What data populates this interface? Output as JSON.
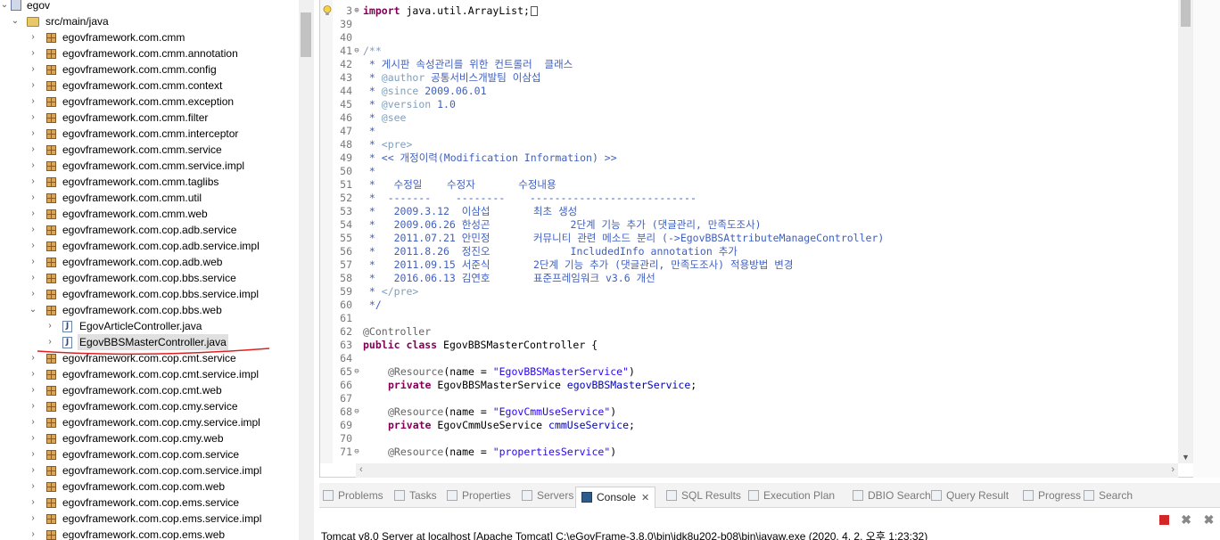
{
  "explorer": {
    "project": "egov",
    "source_folder": "src/main/java",
    "packages_before": [
      "egovframework.com.cmm",
      "egovframework.com.cmm.annotation",
      "egovframework.com.cmm.config",
      "egovframework.com.cmm.context",
      "egovframework.com.cmm.exception",
      "egovframework.com.cmm.filter",
      "egovframework.com.cmm.interceptor",
      "egovframework.com.cmm.service",
      "egovframework.com.cmm.service.impl",
      "egovframework.com.cmm.taglibs",
      "egovframework.com.cmm.util",
      "egovframework.com.cmm.web",
      "egovframework.com.cop.adb.service",
      "egovframework.com.cop.adb.service.impl",
      "egovframework.com.cop.adb.web",
      "egovframework.com.cop.bbs.service",
      "egovframework.com.cop.bbs.service.impl"
    ],
    "expanded_package": "egovframework.com.cop.bbs.web",
    "files": [
      "EgovArticleController.java",
      "EgovBBSMasterController.java"
    ],
    "selected_file": "EgovBBSMasterController.java",
    "packages_after": [
      "egovframework.com.cop.cmt.service",
      "egovframework.com.cop.cmt.service.impl",
      "egovframework.com.cop.cmt.web",
      "egovframework.com.cop.cmy.service",
      "egovframework.com.cop.cmy.service.impl",
      "egovframework.com.cop.cmy.web",
      "egovframework.com.cop.com.service",
      "egovframework.com.cop.com.service.impl",
      "egovframework.com.cop.com.web",
      "egovframework.com.cop.ems.service",
      "egovframework.com.cop.ems.service.impl",
      "egovframework.com.cop.ems.web"
    ]
  },
  "editor": {
    "lines": [
      {
        "n": "3",
        "fold": "⊕",
        "segs": [
          {
            "t": "import ",
            "c": "kw"
          },
          {
            "t": "java.util.ArrayList;"
          }
        ],
        "cursor": true
      },
      {
        "n": "39",
        "segs": []
      },
      {
        "n": "40",
        "segs": []
      },
      {
        "n": "41",
        "fold": "⊖",
        "segs": [
          {
            "t": "/**",
            "c": "jd"
          }
        ]
      },
      {
        "n": "42",
        "segs": [
          {
            "t": " * 게시판 속성관리를 위한 컨트롤러  클래스",
            "c": "cm"
          }
        ]
      },
      {
        "n": "43",
        "segs": [
          {
            "t": " * ",
            "c": "cm"
          },
          {
            "t": "@author",
            "c": "jd"
          },
          {
            "t": " 공통서비스개발팀 이삼섭",
            "c": "cm"
          }
        ]
      },
      {
        "n": "44",
        "segs": [
          {
            "t": " * ",
            "c": "cm"
          },
          {
            "t": "@since",
            "c": "jd"
          },
          {
            "t": " 2009.06.01",
            "c": "cm"
          }
        ]
      },
      {
        "n": "45",
        "segs": [
          {
            "t": " * ",
            "c": "cm"
          },
          {
            "t": "@version",
            "c": "jd"
          },
          {
            "t": " 1.0",
            "c": "cm"
          }
        ]
      },
      {
        "n": "46",
        "segs": [
          {
            "t": " * ",
            "c": "cm"
          },
          {
            "t": "@see",
            "c": "jd"
          }
        ]
      },
      {
        "n": "47",
        "segs": [
          {
            "t": " *",
            "c": "cm"
          }
        ]
      },
      {
        "n": "48",
        "segs": [
          {
            "t": " * ",
            "c": "cm"
          },
          {
            "t": "<pre>",
            "c": "jd"
          }
        ]
      },
      {
        "n": "49",
        "segs": [
          {
            "t": " * << 개정이력(Modification Information) >>",
            "c": "cm"
          }
        ]
      },
      {
        "n": "50",
        "segs": [
          {
            "t": " *",
            "c": "cm"
          }
        ]
      },
      {
        "n": "51",
        "segs": [
          {
            "t": " *   수정일    수정자       수정내용",
            "c": "cm"
          }
        ]
      },
      {
        "n": "52",
        "segs": [
          {
            "t": " *  -------    --------    ---------------------------",
            "c": "cm"
          }
        ]
      },
      {
        "n": "53",
        "segs": [
          {
            "t": " *   2009.3.12  이삼섭       최초 생성",
            "c": "cm"
          }
        ]
      },
      {
        "n": "54",
        "segs": [
          {
            "t": " *   2009.06.26 한성곤             2단계 기능 추가 (댓글관리, 만족도조사)",
            "c": "cm"
          }
        ]
      },
      {
        "n": "55",
        "segs": [
          {
            "t": " *   2011.07.21 안민정       커뮤니티 관련 메소드 분리 (->EgovBBSAttributeManageController)",
            "c": "cm"
          }
        ]
      },
      {
        "n": "56",
        "segs": [
          {
            "t": " *   2011.8.26  정진오             IncludedInfo annotation 추가",
            "c": "cm"
          }
        ]
      },
      {
        "n": "57",
        "segs": [
          {
            "t": " *   2011.09.15 서준식       2단계 기능 추가 (댓글관리, 만족도조사) 적용방법 변경",
            "c": "cm"
          }
        ]
      },
      {
        "n": "58",
        "segs": [
          {
            "t": " *   2016.06.13 김연호       표준프레임워크 v3.6 개선",
            "c": "cm"
          }
        ]
      },
      {
        "n": "59",
        "segs": [
          {
            "t": " * ",
            "c": "cm"
          },
          {
            "t": "</pre>",
            "c": "jd"
          }
        ]
      },
      {
        "n": "60",
        "segs": [
          {
            "t": " */",
            "c": "cm"
          }
        ]
      },
      {
        "n": "61",
        "segs": []
      },
      {
        "n": "62",
        "segs": [
          {
            "t": "@Controller",
            "c": "an"
          }
        ]
      },
      {
        "n": "63",
        "segs": [
          {
            "t": "public ",
            "c": "kw"
          },
          {
            "t": "class ",
            "c": "kw"
          },
          {
            "t": "EgovBBSMasterController {"
          }
        ]
      },
      {
        "n": "64",
        "segs": []
      },
      {
        "n": "65",
        "fold": "⊖",
        "ind": true,
        "segs": [
          {
            "t": "@Resource",
            "c": "an"
          },
          {
            "t": "(name = "
          },
          {
            "t": "\"EgovBBSMasterService\"",
            "c": "st"
          },
          {
            "t": ")"
          }
        ]
      },
      {
        "n": "66",
        "ind": true,
        "segs": [
          {
            "t": "private ",
            "c": "kw"
          },
          {
            "t": "EgovBBSMasterService "
          },
          {
            "t": "egovBBSMasterService",
            "c": "fd"
          },
          {
            "t": ";"
          }
        ]
      },
      {
        "n": "67",
        "segs": []
      },
      {
        "n": "68",
        "fold": "⊖",
        "ind": true,
        "segs": [
          {
            "t": "@Resource",
            "c": "an"
          },
          {
            "t": "(name = "
          },
          {
            "t": "\"EgovCmmUseService\"",
            "c": "st"
          },
          {
            "t": ")"
          }
        ]
      },
      {
        "n": "69",
        "ind": true,
        "segs": [
          {
            "t": "private ",
            "c": "kw"
          },
          {
            "t": "EgovCmmUseService "
          },
          {
            "t": "cmmUseService",
            "c": "fd"
          },
          {
            "t": ";"
          }
        ]
      },
      {
        "n": "70",
        "segs": []
      },
      {
        "n": "71",
        "fold": "⊖",
        "ind": true,
        "segs": [
          {
            "t": "@Resource",
            "c": "an"
          },
          {
            "t": "(name = "
          },
          {
            "t": "\"propertiesService\"",
            "c": "st"
          },
          {
            "t": ")"
          }
        ]
      }
    ]
  },
  "views": {
    "tabs": [
      {
        "label": "Problems",
        "icon": "problems-icon"
      },
      {
        "label": "Tasks",
        "icon": "tasks-icon"
      },
      {
        "label": "Properties",
        "icon": "properties-icon"
      },
      {
        "label": "Servers",
        "icon": "servers-icon"
      },
      {
        "label": "Console",
        "icon": "console-icon",
        "active": true
      },
      {
        "label": "SQL Results",
        "icon": "sql-results-icon"
      },
      {
        "label": "Execution Plan",
        "icon": "execution-plan-icon"
      },
      {
        "label": "DBIO Search",
        "icon": "dbio-search-icon"
      },
      {
        "label": "Query Result",
        "icon": "query-result-icon"
      },
      {
        "label": "Progress",
        "icon": "progress-icon"
      },
      {
        "label": "Search",
        "icon": "search-icon"
      }
    ],
    "close_glyph": "✕",
    "console_description": "Tomcat v8.0 Server at localhost [Apache Tomcat] C:\\eGovFrame-3.8.0\\bin\\jdk8u202-b08\\bin\\javaw.exe (2020. 4. 2. 오후 1:23:32)"
  },
  "colors": {
    "keyword": "#7f0055",
    "comment": "#3f5fbf",
    "javadoc_tag": "#7f9fbf",
    "string": "#2a00ff",
    "annotation": "#646464",
    "field": "#0000c0",
    "underline_annotation": "#e02020",
    "stop_button": "#d42626"
  }
}
